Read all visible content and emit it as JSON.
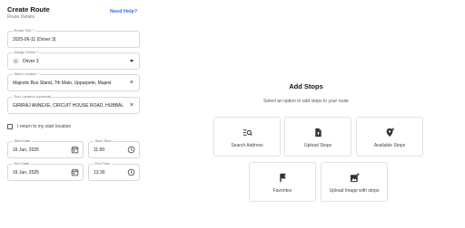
{
  "header": {
    "title": "Create Route",
    "subtitle": "Route Details",
    "help_link": "Need Help?"
  },
  "form": {
    "route_title": {
      "label": "Route Title",
      "required": "*",
      "value": "2025-06-11 (Driver 3)"
    },
    "assign_driver": {
      "label": "Assign Driver",
      "required": "*",
      "value": "Driver 3",
      "avatar": "D"
    },
    "start_location": {
      "label": "Start Location",
      "required": "*",
      "value": "Majestic Bus Stand, 7th Main, Upparpete, Majest"
    },
    "end_location": {
      "label": "End Location (optional)",
      "value": "GIRIRAJ ANNEXE, CIRCUIT HOUSE ROAD, HUBBALLI,"
    },
    "return_checkbox": {
      "label": "I return to my start location",
      "checked": false
    },
    "start_date": {
      "label": "Start Date",
      "value": "16 Jun, 2025"
    },
    "start_time": {
      "label": "Start Time",
      "value": "11:00"
    },
    "end_date": {
      "label": "End Date",
      "value": "16 Jun, 2025"
    },
    "end_time": {
      "label": "End Time",
      "value": "13:30"
    },
    "clear_symbol": "×"
  },
  "stops": {
    "title": "Add Stops",
    "subtitle": "Select an option to add stops to your route",
    "options": [
      {
        "label": "Search Address",
        "icon": "search-list-icon"
      },
      {
        "label": "Upload Stops",
        "icon": "upload-file-icon"
      },
      {
        "label": "Available Stops",
        "icon": "add-location-icon"
      },
      {
        "label": "Favorites",
        "icon": "bookmark-flag-icon"
      },
      {
        "label": "Upload Image with stops",
        "icon": "add-image-icon"
      }
    ]
  },
  "colors": {
    "accent": "#3a6fd8",
    "required": "#e53935",
    "icon": "#333333"
  }
}
